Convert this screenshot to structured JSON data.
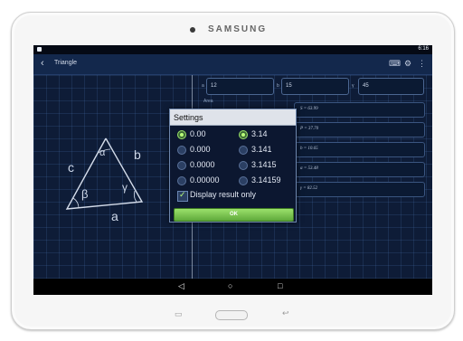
{
  "device": {
    "brand": "SAMSUNG"
  },
  "statusbar": {
    "time": "6:16"
  },
  "actionbar": {
    "back_icon": "arrow-back-icon",
    "title": "Triangle",
    "icons": [
      "keyboard-icon",
      "gear-icon",
      "overflow-menu-icon"
    ]
  },
  "inputs": [
    {
      "label": "a",
      "value": "12"
    },
    {
      "label": "b",
      "value": "15"
    },
    {
      "label": "γ",
      "value": "45"
    }
  ],
  "results": {
    "area_label": "Area",
    "values": [
      "S = 63.99",
      "P = 37.70",
      "b = 10.65",
      "α = 53.48",
      "γ = 82.52"
    ]
  },
  "triangle": {
    "sides": [
      "c",
      "b",
      "a"
    ],
    "angles": [
      "α",
      "β",
      "γ"
    ]
  },
  "dialog": {
    "title": "Settings",
    "left_options": [
      {
        "label": "0.00",
        "selected": true
      },
      {
        "label": "0.000",
        "selected": false
      },
      {
        "label": "0.0000",
        "selected": false
      },
      {
        "label": "0.00000",
        "selected": false
      }
    ],
    "right_options": [
      {
        "label": "3.14",
        "selected": true
      },
      {
        "label": "3.141",
        "selected": false
      },
      {
        "label": "3.1415",
        "selected": false
      },
      {
        "label": "3.14159",
        "selected": false
      }
    ],
    "checkbox_label": "Display result only",
    "checkbox_checked": true,
    "ok_label": "OK"
  },
  "navbar": {
    "icons": [
      "back-nav-icon",
      "home-nav-icon",
      "recents-nav-icon"
    ]
  },
  "colors": {
    "accent": "#7fcf4e",
    "background": "#0e1c37"
  }
}
